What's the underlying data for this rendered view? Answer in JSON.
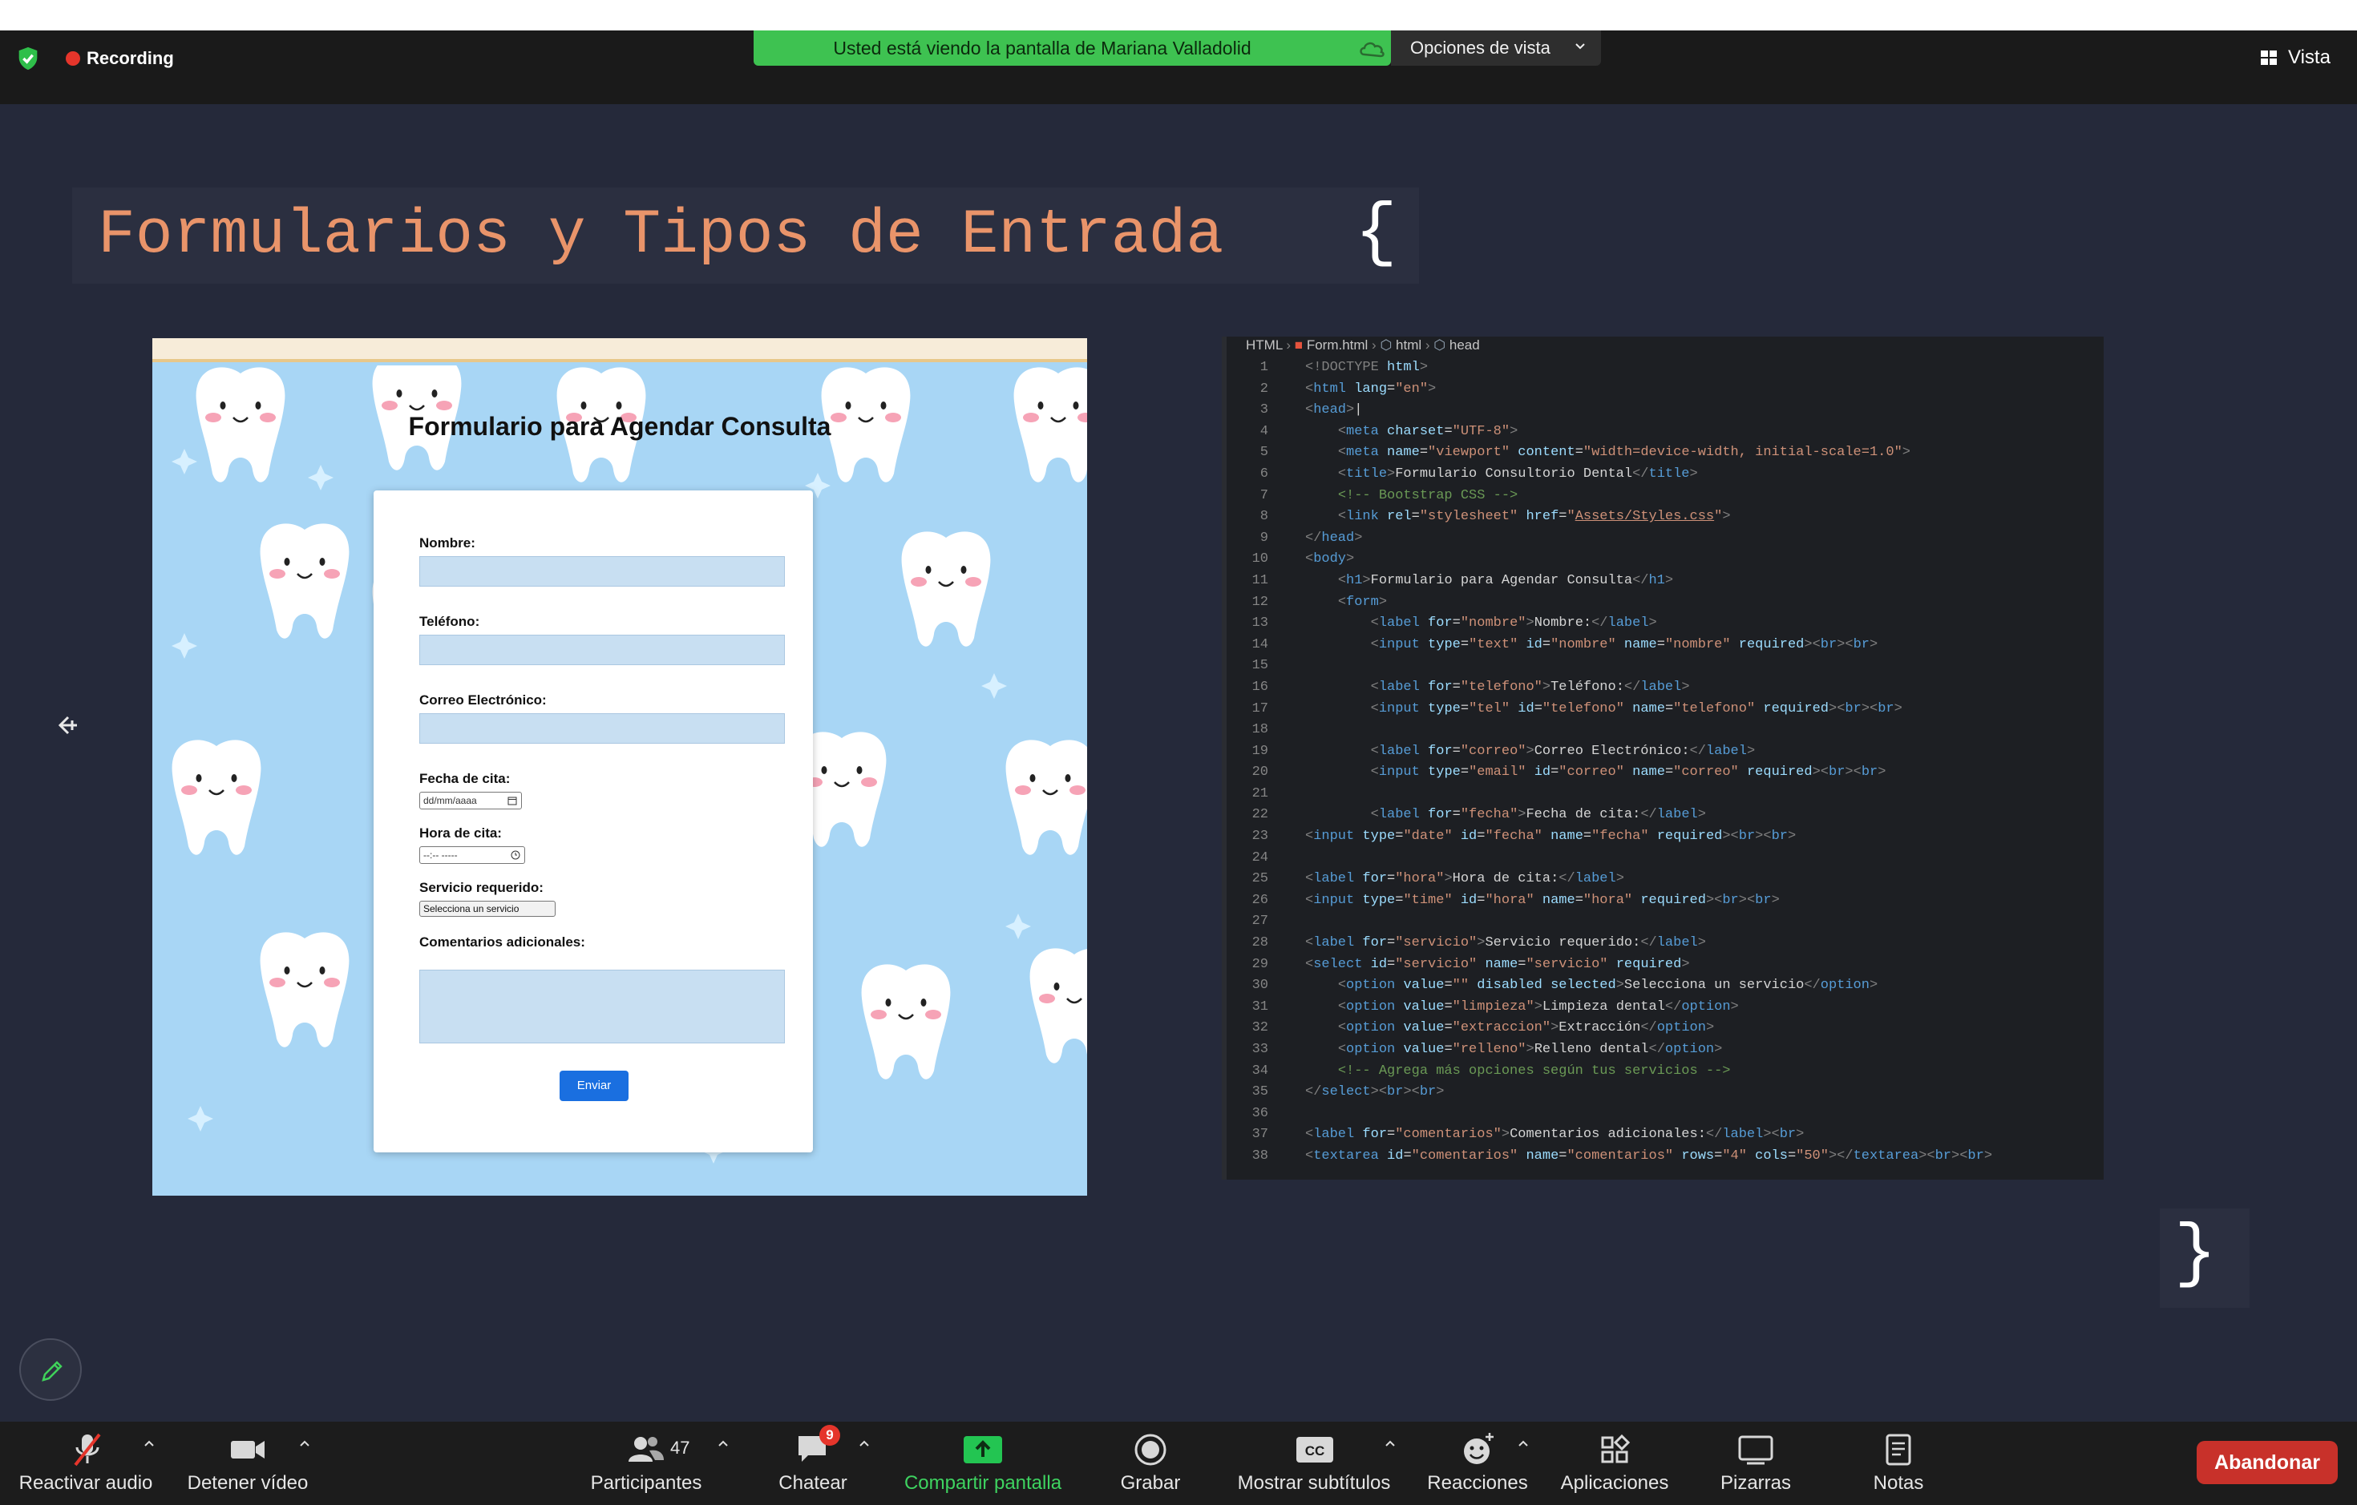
{
  "meeting": {
    "recording_label": "Recording",
    "share_banner": "Usted está viendo la pantalla de Mariana Valladolid",
    "view_options": "Opciones de vista",
    "view_button": "Vista"
  },
  "slide": {
    "title": "Formularios y Tipos de Entrada",
    "brace_open": "{",
    "brace_close": "}",
    "form_preview": {
      "heading": "Formulario para Agendar Consulta",
      "fields": {
        "nombre": "Nombre:",
        "telefono": "Teléfono:",
        "correo": "Correo Electrónico:",
        "fecha": "Fecha de cita:",
        "fecha_placeholder": "dd/mm/aaaa",
        "hora": "Hora de cita:",
        "hora_placeholder": "--:-- -----",
        "servicio": "Servicio requerido:",
        "servicio_selected": "Selecciona un servicio",
        "comentarios": "Comentarios adicionales:"
      },
      "submit": "Enviar"
    },
    "code_panel": {
      "breadcrumb": [
        "HTML",
        "Form.html",
        "html",
        "head"
      ],
      "lines": [
        {
          "n": "1",
          "html": "<span class=\"bk\">&lt;!DOCTYPE</span> <span class=\"at\">html</span><span class=\"bk\">&gt;</span>"
        },
        {
          "n": "2",
          "html": "<span class=\"bk\">&lt;</span><span class=\"tg\">html</span> <span class=\"at\">lang</span>=<span class=\"st\">\"en\"</span><span class=\"bk\">&gt;</span>"
        },
        {
          "n": "3",
          "html": "<span class=\"bk\">&lt;</span><span class=\"tg\">head</span><span class=\"bk\">&gt;</span>|"
        },
        {
          "n": "4",
          "html": "    <span class=\"bk\">&lt;</span><span class=\"tg\">meta</span> <span class=\"at\">charset</span>=<span class=\"st\">\"UTF-8\"</span><span class=\"bk\">&gt;</span>"
        },
        {
          "n": "5",
          "html": "    <span class=\"bk\">&lt;</span><span class=\"tg\">meta</span> <span class=\"at\">name</span>=<span class=\"st\">\"viewport\"</span> <span class=\"at\">content</span>=<span class=\"st\">\"width=device-width, initial-scale=1.0\"</span><span class=\"bk\">&gt;</span>"
        },
        {
          "n": "6",
          "html": "    <span class=\"bk\">&lt;</span><span class=\"tg\">title</span><span class=\"bk\">&gt;</span>Formulario Consultorio Dental<span class=\"bk\">&lt;/</span><span class=\"tg\">title</span><span class=\"bk\">&gt;</span>"
        },
        {
          "n": "7",
          "html": "    <span class=\"cm\">&lt;!-- Bootstrap CSS --&gt;</span>"
        },
        {
          "n": "8",
          "html": "    <span class=\"bk\">&lt;</span><span class=\"tg\">link</span> <span class=\"at\">rel</span>=<span class=\"st\">\"stylesheet\"</span> <span class=\"at\">href</span>=<span class=\"st\">\"<u>Assets/Styles.css</u>\"</span><span class=\"bk\">&gt;</span>"
        },
        {
          "n": "9",
          "html": "<span class=\"bk\">&lt;/</span><span class=\"tg\">head</span><span class=\"bk\">&gt;</span>"
        },
        {
          "n": "10",
          "html": "<span class=\"bk\">&lt;</span><span class=\"tg\">body</span><span class=\"bk\">&gt;</span>"
        },
        {
          "n": "11",
          "html": "    <span class=\"bk\">&lt;</span><span class=\"tg\">h1</span><span class=\"bk\">&gt;</span>Formulario para Agendar Consulta<span class=\"bk\">&lt;/</span><span class=\"tg\">h1</span><span class=\"bk\">&gt;</span>"
        },
        {
          "n": "12",
          "html": "    <span class=\"bk\">&lt;</span><span class=\"tg\">form</span><span class=\"bk\">&gt;</span>"
        },
        {
          "n": "13",
          "html": "        <span class=\"bk\">&lt;</span><span class=\"tg\">label</span> <span class=\"at\">for</span>=<span class=\"st\">\"nombre\"</span><span class=\"bk\">&gt;</span>Nombre:<span class=\"bk\">&lt;/</span><span class=\"tg\">label</span><span class=\"bk\">&gt;</span>"
        },
        {
          "n": "14",
          "html": "        <span class=\"bk\">&lt;</span><span class=\"tg\">input</span> <span class=\"at\">type</span>=<span class=\"st\">\"text\"</span> <span class=\"at\">id</span>=<span class=\"st\">\"nombre\"</span> <span class=\"at\">name</span>=<span class=\"st\">\"nombre\"</span> <span class=\"at\">required</span><span class=\"bk\">&gt;&lt;</span><span class=\"tg\">br</span><span class=\"bk\">&gt;&lt;</span><span class=\"tg\">br</span><span class=\"bk\">&gt;</span>"
        },
        {
          "n": "15",
          "html": ""
        },
        {
          "n": "16",
          "html": "        <span class=\"bk\">&lt;</span><span class=\"tg\">label</span> <span class=\"at\">for</span>=<span class=\"st\">\"telefono\"</span><span class=\"bk\">&gt;</span>Teléfono:<span class=\"bk\">&lt;/</span><span class=\"tg\">label</span><span class=\"bk\">&gt;</span>"
        },
        {
          "n": "17",
          "html": "        <span class=\"bk\">&lt;</span><span class=\"tg\">input</span> <span class=\"at\">type</span>=<span class=\"st\">\"tel\"</span> <span class=\"at\">id</span>=<span class=\"st\">\"telefono\"</span> <span class=\"at\">name</span>=<span class=\"st\">\"telefono\"</span> <span class=\"at\">required</span><span class=\"bk\">&gt;&lt;</span><span class=\"tg\">br</span><span class=\"bk\">&gt;&lt;</span><span class=\"tg\">br</span><span class=\"bk\">&gt;</span>"
        },
        {
          "n": "18",
          "html": ""
        },
        {
          "n": "19",
          "html": "        <span class=\"bk\">&lt;</span><span class=\"tg\">label</span> <span class=\"at\">for</span>=<span class=\"st\">\"correo\"</span><span class=\"bk\">&gt;</span>Correo Electrónico:<span class=\"bk\">&lt;/</span><span class=\"tg\">label</span><span class=\"bk\">&gt;</span>"
        },
        {
          "n": "20",
          "html": "        <span class=\"bk\">&lt;</span><span class=\"tg\">input</span> <span class=\"at\">type</span>=<span class=\"st\">\"email\"</span> <span class=\"at\">id</span>=<span class=\"st\">\"correo\"</span> <span class=\"at\">name</span>=<span class=\"st\">\"correo\"</span> <span class=\"at\">required</span><span class=\"bk\">&gt;&lt;</span><span class=\"tg\">br</span><span class=\"bk\">&gt;&lt;</span><span class=\"tg\">br</span><span class=\"bk\">&gt;</span>"
        },
        {
          "n": "21",
          "html": ""
        },
        {
          "n": "22",
          "html": "        <span class=\"bk\">&lt;</span><span class=\"tg\">label</span> <span class=\"at\">for</span>=<span class=\"st\">\"fecha\"</span><span class=\"bk\">&gt;</span>Fecha de cita:<span class=\"bk\">&lt;/</span><span class=\"tg\">label</span><span class=\"bk\">&gt;</span>"
        },
        {
          "n": "23",
          "html": "<span class=\"bk\">&lt;</span><span class=\"tg\">input</span> <span class=\"at\">type</span>=<span class=\"st\">\"date\"</span> <span class=\"at\">id</span>=<span class=\"st\">\"fecha\"</span> <span class=\"at\">name</span>=<span class=\"st\">\"fecha\"</span> <span class=\"at\">required</span><span class=\"bk\">&gt;&lt;</span><span class=\"tg\">br</span><span class=\"bk\">&gt;&lt;</span><span class=\"tg\">br</span><span class=\"bk\">&gt;</span>"
        },
        {
          "n": "24",
          "html": ""
        },
        {
          "n": "25",
          "html": "<span class=\"bk\">&lt;</span><span class=\"tg\">label</span> <span class=\"at\">for</span>=<span class=\"st\">\"hora\"</span><span class=\"bk\">&gt;</span>Hora de cita:<span class=\"bk\">&lt;/</span><span class=\"tg\">label</span><span class=\"bk\">&gt;</span>"
        },
        {
          "n": "26",
          "html": "<span class=\"bk\">&lt;</span><span class=\"tg\">input</span> <span class=\"at\">type</span>=<span class=\"st\">\"time\"</span> <span class=\"at\">id</span>=<span class=\"st\">\"hora\"</span> <span class=\"at\">name</span>=<span class=\"st\">\"hora\"</span> <span class=\"at\">required</span><span class=\"bk\">&gt;&lt;</span><span class=\"tg\">br</span><span class=\"bk\">&gt;&lt;</span><span class=\"tg\">br</span><span class=\"bk\">&gt;</span>"
        },
        {
          "n": "27",
          "html": ""
        },
        {
          "n": "28",
          "html": "<span class=\"bk\">&lt;</span><span class=\"tg\">label</span> <span class=\"at\">for</span>=<span class=\"st\">\"servicio\"</span><span class=\"bk\">&gt;</span>Servicio requerido:<span class=\"bk\">&lt;/</span><span class=\"tg\">label</span><span class=\"bk\">&gt;</span>"
        },
        {
          "n": "29",
          "html": "<span class=\"bk\">&lt;</span><span class=\"tg\">select</span> <span class=\"at\">id</span>=<span class=\"st\">\"servicio\"</span> <span class=\"at\">name</span>=<span class=\"st\">\"servicio\"</span> <span class=\"at\">required</span><span class=\"bk\">&gt;</span>"
        },
        {
          "n": "30",
          "html": "    <span class=\"bk\">&lt;</span><span class=\"tg\">option</span> <span class=\"at\">value</span>=<span class=\"st\">\"\"</span> <span class=\"at\">disabled selected</span><span class=\"bk\">&gt;</span>Selecciona un servicio<span class=\"bk\">&lt;/</span><span class=\"tg\">option</span><span class=\"bk\">&gt;</span>"
        },
        {
          "n": "31",
          "html": "    <span class=\"bk\">&lt;</span><span class=\"tg\">option</span> <span class=\"at\">value</span>=<span class=\"st\">\"limpieza\"</span><span class=\"bk\">&gt;</span>Limpieza dental<span class=\"bk\">&lt;/</span><span class=\"tg\">option</span><span class=\"bk\">&gt;</span>"
        },
        {
          "n": "32",
          "html": "    <span class=\"bk\">&lt;</span><span class=\"tg\">option</span> <span class=\"at\">value</span>=<span class=\"st\">\"extraccion\"</span><span class=\"bk\">&gt;</span>Extracción<span class=\"bk\">&lt;/</span><span class=\"tg\">option</span><span class=\"bk\">&gt;</span>"
        },
        {
          "n": "33",
          "html": "    <span class=\"bk\">&lt;</span><span class=\"tg\">option</span> <span class=\"at\">value</span>=<span class=\"st\">\"relleno\"</span><span class=\"bk\">&gt;</span>Relleno dental<span class=\"bk\">&lt;/</span><span class=\"tg\">option</span><span class=\"bk\">&gt;</span>"
        },
        {
          "n": "34",
          "html": "    <span class=\"cm\">&lt;!-- Agrega más opciones según tus servicios --&gt;</span>"
        },
        {
          "n": "35",
          "html": "<span class=\"bk\">&lt;/</span><span class=\"tg\">select</span><span class=\"bk\">&gt;&lt;</span><span class=\"tg\">br</span><span class=\"bk\">&gt;&lt;</span><span class=\"tg\">br</span><span class=\"bk\">&gt;</span>"
        },
        {
          "n": "36",
          "html": ""
        },
        {
          "n": "37",
          "html": "<span class=\"bk\">&lt;</span><span class=\"tg\">label</span> <span class=\"at\">for</span>=<span class=\"st\">\"comentarios\"</span><span class=\"bk\">&gt;</span>Comentarios adicionales:<span class=\"bk\">&lt;/</span><span class=\"tg\">label</span><span class=\"bk\">&gt;&lt;</span><span class=\"tg\">br</span><span class=\"bk\">&gt;</span>"
        },
        {
          "n": "38",
          "html": "<span class=\"bk\">&lt;</span><span class=\"tg\">textarea</span> <span class=\"at\">id</span>=<span class=\"st\">\"comentarios\"</span> <span class=\"at\">name</span>=<span class=\"st\">\"comentarios\"</span> <span class=\"at\">rows</span>=<span class=\"st\">\"4\"</span> <span class=\"at\">cols</span>=<span class=\"st\">\"50\"</span><span class=\"bk\">&gt;&lt;/</span><span class=\"tg\">textarea</span><span class=\"bk\">&gt;&lt;</span><span class=\"tg\">br</span><span class=\"bk\">&gt;&lt;</span><span class=\"tg\">br</span><span class=\"bk\">&gt;</span>"
        }
      ]
    }
  },
  "toolbar": {
    "reactivar_audio": "Reactivar audio",
    "detener_video": "Detener vídeo",
    "participantes": "Participantes",
    "participant_count": "47",
    "chatear": "Chatear",
    "chat_badge": "9",
    "compartir": "Compartir pantalla",
    "grabar": "Grabar",
    "subtitulos": "Mostrar subtítulos",
    "reacciones": "Reacciones",
    "aplicaciones": "Aplicaciones",
    "pizarras": "Pizarras",
    "notas": "Notas",
    "abandonar": "Abandonar"
  },
  "colors": {
    "share_green": "#3ec251",
    "slide_bg": "#25293a",
    "title_orange": "#e9946a",
    "leave_red": "#c8312a",
    "share_icon_green": "#23c552"
  }
}
